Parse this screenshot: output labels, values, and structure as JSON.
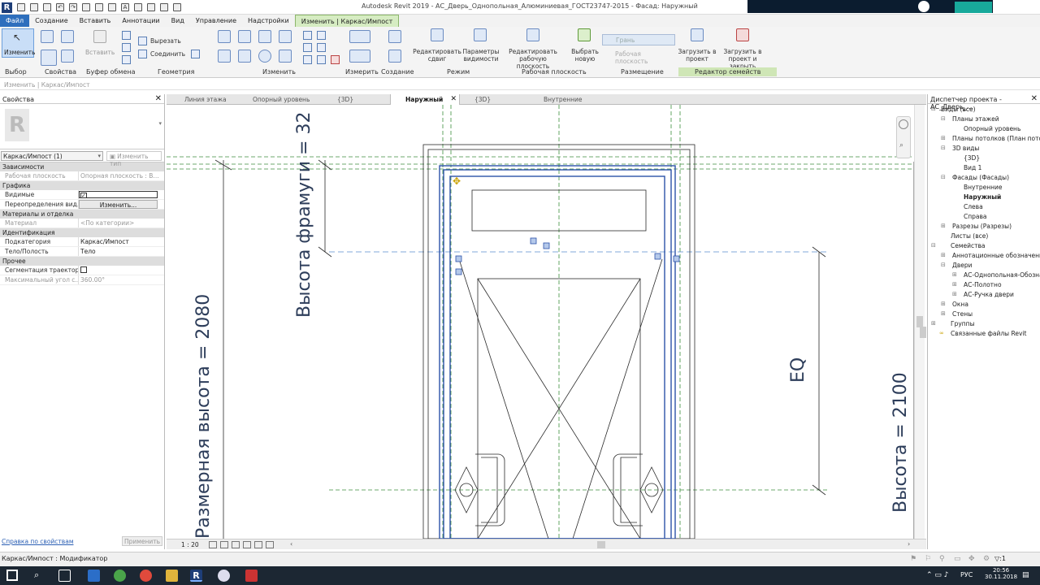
{
  "app": {
    "title": "Autodesk Revit 2019 - АС_Дверь_Однопольная_Алюминиевая_ГОСТ23747-2015 - Фасад: Наружный",
    "logo": "R"
  },
  "menu_tabs": [
    "Файл",
    "Создание",
    "Вставить",
    "Аннотации",
    "Вид",
    "Управление",
    "Надстройки",
    "Изменить | Каркас/Импост"
  ],
  "ribbon": {
    "modify_label": "Изменить",
    "paste_label": "Вставить",
    "cut_label": "Вырезать",
    "join_label": "Соединить",
    "edit_sweep": "Редактировать сдвиг",
    "vis_params": "Параметры видимости",
    "edit_workplane": "Редактировать рабочую плоскость",
    "pick_new": "Выбрать новую",
    "face_label": "Грань",
    "workplane_label": "Рабочая плоскость",
    "load_project": "Загрузить в проект",
    "load_close": "Загрузить в проект и закрыть",
    "groups": [
      "Выбор",
      "Свойства",
      "Буфер обмена",
      "Геометрия",
      "Изменить",
      "Измерить",
      "Создание",
      "Режим",
      "Рабочая плоскость",
      "Размещение",
      "Редактор семейств"
    ]
  },
  "context_hint": "Изменить | Каркас/Импост",
  "properties": {
    "title": "Свойства",
    "type_selector": "Каркас/Импост (1)",
    "edit_type": "Изменить тип",
    "sections": {
      "constraints": "Зависимости",
      "graphics": "Графика",
      "materials": "Материалы и отделка",
      "identity": "Идентификация",
      "other": "Прочее"
    },
    "rows": {
      "workplane_k": "Рабочая плоскость",
      "workplane_v": "Опорная плоскость : В...",
      "visible_k": "Видимые",
      "overrides_k": "Переопределения вид...",
      "overrides_v": "Изменить...",
      "material_k": "Материал",
      "material_v": "<По категории>",
      "subcat_k": "Подкатегория",
      "subcat_v": "Каркас/Импост",
      "solid_k": "Тело/Полость",
      "solid_v": "Тело",
      "segment_k": "Сегментация траектор...",
      "maxangle_k": "Максимальный угол с...",
      "maxangle_v": "360.00°"
    },
    "help_link": "Справка по свойствам",
    "apply": "Применить"
  },
  "view_tabs": [
    "Линия этажа",
    "Опорный уровень",
    "{3D}",
    "Наружный",
    "{3D}",
    "Внутренние"
  ],
  "drawing": {
    "dim_left": "Высота фрамуги = 32",
    "dim_bottom_left": "Размерная высота = 2080",
    "dim_eq": "EQ",
    "dim_right": "Высота = 2100"
  },
  "view_scale": "1 : 20",
  "browser": {
    "title": "Диспетчер проекта - АС_Дверь_...",
    "items": [
      "Виды (все)",
      "Планы этажей",
      "Опорный уровень",
      "Планы потолков (План потолк...",
      "3D виды",
      "{3D}",
      "Вид 1",
      "Фасады (Фасады)",
      "Внутренние",
      "Наружный",
      "Слева",
      "Справа",
      "Разрезы (Разрезы)",
      "Листы (все)",
      "Семейства",
      "Аннотационные обозначени...",
      "Двери",
      "АС-Однопольная-Обозна...",
      "АС-Полотно",
      "АС-Ручка двери",
      "Окна",
      "Стены",
      "Группы",
      "Связанные файлы Revit"
    ]
  },
  "status": {
    "text": "Каркас/Импост : Модификатор",
    "filter": ":1",
    "lang": "РУС",
    "time": "20:56",
    "date": "30.11.2018"
  }
}
